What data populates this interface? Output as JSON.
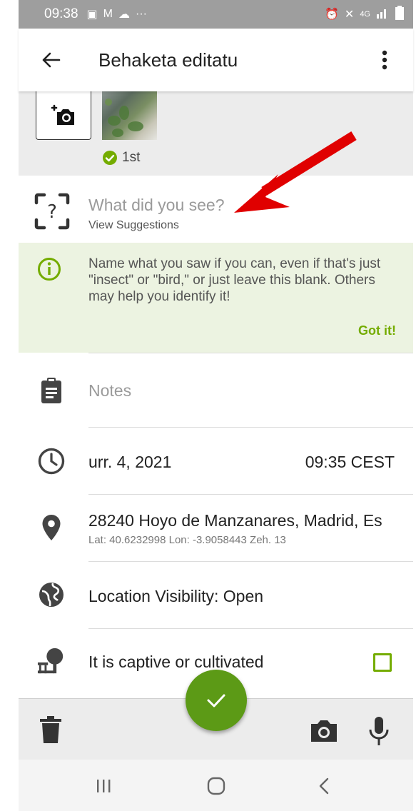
{
  "status_bar": {
    "time": "09:38",
    "network": "4G"
  },
  "app_bar": {
    "title": "Behaketa editatu"
  },
  "photos": {
    "rank_label": "1st"
  },
  "species": {
    "placeholder": "What did you see?",
    "suggestions_link": "View Suggestions"
  },
  "tip": {
    "text": "Name what you saw if you can, even if that's just \"insect\" or \"bird,\" or just leave this blank. Others may help you identify it!",
    "dismiss_label": "Got it!"
  },
  "notes": {
    "placeholder": "Notes"
  },
  "datetime": {
    "date": "urr. 4, 2021",
    "time": "09:35 CEST"
  },
  "location": {
    "name": "28240 Hoyo de Manzanares, Madrid, Es",
    "coords": "Lat: 40.6232998 Lon: -3.9058443 Zeh. 13"
  },
  "visibility": {
    "label": "Location Visibility: Open"
  },
  "captive": {
    "label": "It is captive or cultivated",
    "checked": false
  },
  "colors": {
    "accent_green": "#74ac00",
    "fab_green": "#5c9a16",
    "tip_background": "#ecf3e1",
    "annotation_red": "#e00000"
  },
  "icons": {
    "add_photo": "add-photo-icon",
    "species": "unknown-species-icon",
    "tip": "info-icon",
    "notes": "clipboard-icon",
    "date": "clock-icon",
    "location": "map-pin-icon",
    "visibility": "globe-icon",
    "captive": "captive-tree-icon",
    "delete": "trash-icon",
    "camera": "camera-icon",
    "mic": "microphone-icon",
    "save": "checkmark-icon"
  }
}
